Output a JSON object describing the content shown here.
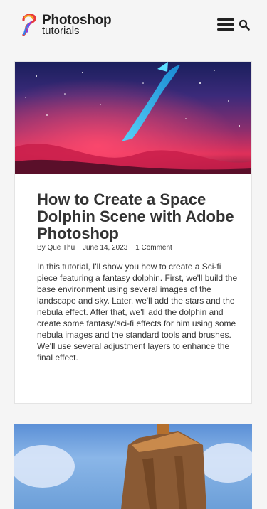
{
  "header": {
    "logo_title": "Photoshop",
    "logo_subtitle": "tutorials",
    "menu_icon": "hamburger-menu-icon",
    "search_icon": "search-icon"
  },
  "post": {
    "title": "How to Create a Space Dolphin Scene with Adobe Photoshop",
    "author": "By Que Thu",
    "date": "June 14, 2023",
    "comments": "1 Comment",
    "excerpt": "In this tutorial, I'll show you how to create a Sci-fi piece featuring a fantasy dolphin. First, we'll build the base environment using several images of the landscape and sky. Later, we'll add the stars and the nebula effect.  After that, we'll add the dolphin and create some fantasy/sci-fi effects for him using some nebula images and the standard tools and brushes. We'll use several adjustment layers to enhance the final effect."
  },
  "colors": {
    "background": "#f5f5f5",
    "card": "#ffffff",
    "text": "#333333"
  }
}
